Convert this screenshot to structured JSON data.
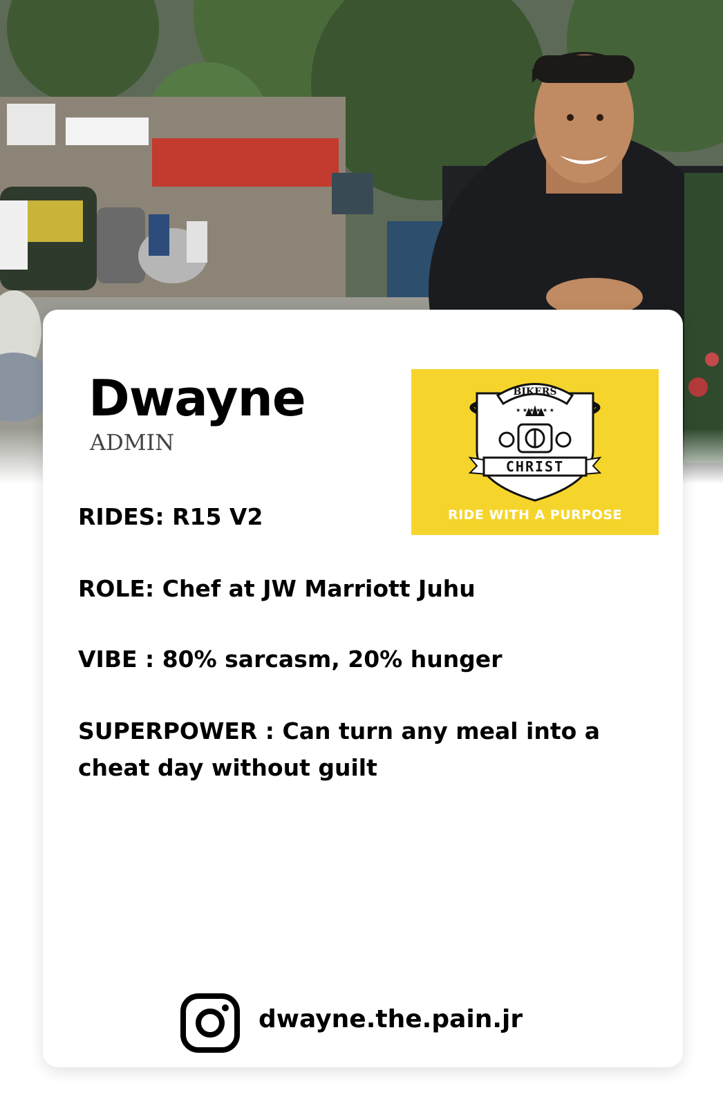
{
  "profile": {
    "name": "Dwayne",
    "title": "ADMIN"
  },
  "logo": {
    "top_text": "BIKERS",
    "banner_text": "CHRIST",
    "tagline": "RIDE WITH A PURPOSE",
    "background_color": "#f5d52c"
  },
  "facts": [
    "RIDES: R15 V2",
    "ROLE: Chef at JW Marriott Juhu",
    "VIBE : 80% sarcasm, 20% hunger",
    "SUPERPOWER : Can turn any meal into a cheat day without guilt"
  ],
  "social": {
    "icon": "instagram-icon",
    "handle": "dwayne.the.pain.jr"
  }
}
